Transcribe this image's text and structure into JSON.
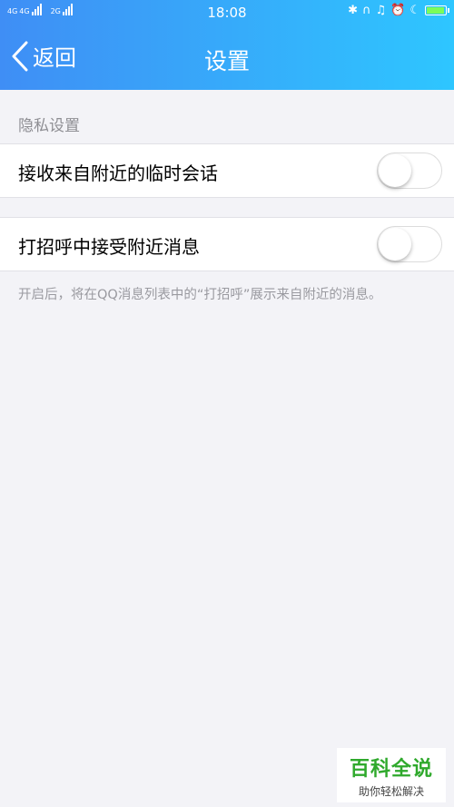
{
  "status_bar": {
    "network_left": "4G",
    "network_left2": "4G",
    "network_right": "2G",
    "time": "18:08",
    "icons": [
      "bluetooth-icon",
      "headset-icon",
      "silent-icon",
      "alarm-icon",
      "moon-icon",
      "battery-icon"
    ]
  },
  "nav": {
    "back_label": "返回",
    "title": "设置"
  },
  "privacy": {
    "section_title": "隐私设置",
    "items": [
      {
        "label": "接收来自附近的临时会话",
        "enabled": false
      },
      {
        "label": "打招呼中接受附近消息",
        "enabled": false
      }
    ],
    "note": "开启后，将在QQ消息列表中的“打招呼”展示来自附近的消息。"
  },
  "watermark": {
    "main": "百科全说",
    "sub": "助你轻松解决"
  },
  "colors": {
    "header_start": "#3f8ef5",
    "header_end": "#2ec6ff",
    "background": "#f3f3f7"
  }
}
